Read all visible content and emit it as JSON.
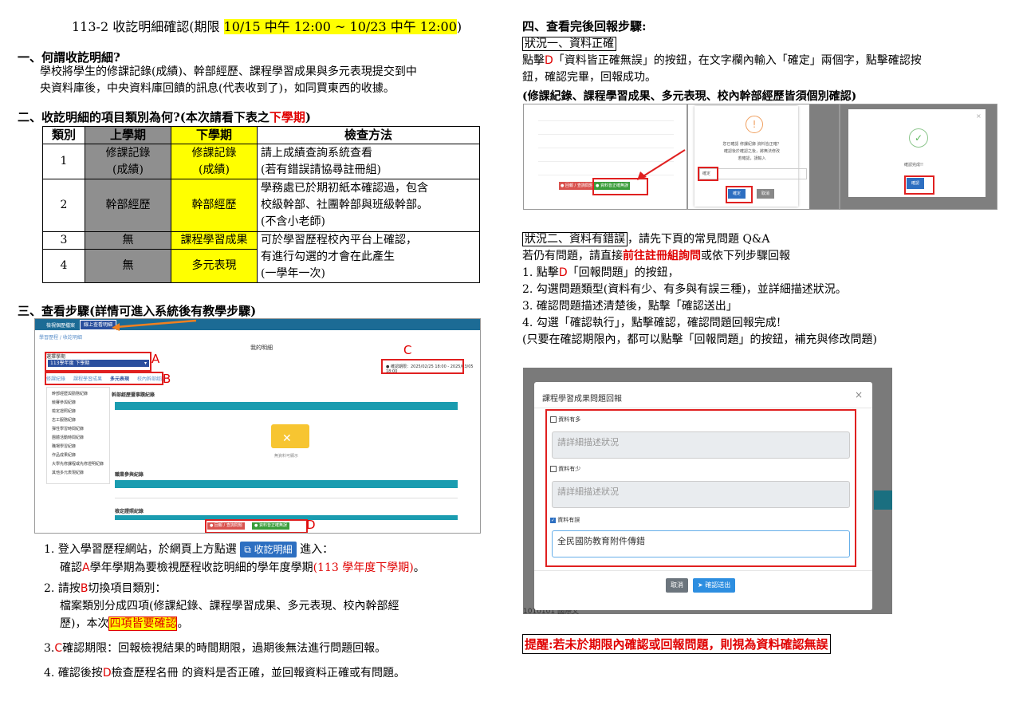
{
  "title": {
    "prefix": "113-2 收訖明細確認(期限 ",
    "deadline": "10/15 中午 12:00 ~ 10/23 中午 12:00",
    "suffix": ")"
  },
  "s1": {
    "heading": "一、何謂收訖明細?",
    "line1": "學校將學生的修課記錄(成績)、幹部經歷、課程學習成果與多元表現提交到中",
    "line2": "央資料庫後，中央資料庫回饋的訊息(代表收到了)，如同買東西的收據。"
  },
  "s2": {
    "heading": "二、收訖明細的項目類別為何?(本次請看下表之",
    "heading_red": "下學期",
    "heading_end": ")"
  },
  "table": {
    "headers": [
      "類別",
      "上學期",
      "下學期",
      "檢查方法"
    ],
    "rows": [
      {
        "no": "1",
        "prev": "修課記錄\n(成績)",
        "cur": "修課記錄\n(成績)",
        "method": "請上成績查詢系統查看\n(若有錯誤請協尋註冊組)"
      },
      {
        "no": "2",
        "prev": "幹部經歷",
        "cur": "幹部經歷",
        "method": "學務處已於期初紙本確認過，包含\n校級幹部、社團幹部與班級幹部。\n(不含小老師)"
      },
      {
        "no": "3",
        "prev": "無",
        "cur": "課程學習成果",
        "method": "可於學習歷程校內平台上確認，\n有進行勾選的才會在此產生\n(一學年一次)"
      },
      {
        "no": "4",
        "prev": "無",
        "cur": "多元表現"
      }
    ]
  },
  "s3": {
    "heading": "三、查看步驟(詳情可進入系統後有教學步驟)"
  },
  "screenshot1": {
    "tab1": "檢視個歷檔案",
    "tab2": "線上查看明細",
    "crumb": "學習歷程 / 收訖明細",
    "page_title": "我的明細",
    "select_label": "選擇學期",
    "select_value": "113學年度 下學期",
    "tabs": [
      "修課紀錄",
      "課程學習成果",
      "多元表現",
      "校內幹部經歷"
    ],
    "deadline_text": "● 確認期限：2025/02/25 18:00 - 2025/03/05 18:00",
    "side": [
      "幹部經歷與勤務紀錄",
      "競賽參與紀錄",
      "檢定證照紀錄",
      "志工服務紀錄",
      "彈性學習時間紀錄",
      "團體活動時間紀錄",
      "職場學習紀錄",
      "作品成果紀錄",
      "大學先修課程或先修證明紀錄",
      "其他多元表現紀錄"
    ],
    "section1": "幹部經歷暨事蹟紀錄",
    "empty": "無資料可顯示",
    "section2": "職業參與紀錄",
    "section3": "檢定證照紀錄",
    "btn_report": "● 回報 / 查詢問題",
    "btn_ok": "● 資料皆正確無誤",
    "labels": [
      "A",
      "B",
      "C",
      "D"
    ]
  },
  "steps": {
    "s1_a": "1. 登入學習歷程網站，於網頁上方點選",
    "s1_btn": "收訖明細",
    "s1_b": "進入：",
    "s1_2a": "確認",
    "s1_A": "A",
    "s1_2b": "學年學期為要檢視歷程收訖明細的學年度學期",
    "s1_2c": "(113 學年度下學期)",
    "s1_2d": "。",
    "s2_a": "2. 請按",
    "s2_B": "B",
    "s2_b": "切換項目類別：",
    "s2_2": "檔案類別分成四項(修課紀錄、課程學習成果、多元表現、校內幹部經",
    "s2_3a": "歷)，本次",
    "s2_3hl": "四項皆要確認",
    "s2_3b": "。",
    "s3_a": "3.",
    "s3_C": "C",
    "s3_b": "確認期限：回報檢視結果的時間期限，過期後無法進行問題回報。",
    "s4_a": "4. 確認後按",
    "s4_D": "D",
    "s4_b": "檢查歷程名冊 的資料是否正確，並回報資料正確或有問題。"
  },
  "s4": {
    "heading": "四、查看完後回報步驟:",
    "case1": "狀況一、資料正確",
    "c1_l1a": "點擊",
    "c1_D": "D",
    "c1_l1b": "「資料皆正確無誤」的按鈕，在文字欄內輸入「確定」兩個字，點擊確認按",
    "c1_l2": "鈕，確認完畢，回報成功。",
    "c1_bold": "(修課紀錄、課程學習成果、多元表現、校內幹部經歷皆須個別確認)"
  },
  "shot2": {
    "btn_report": "● 回報 / 查詢問題",
    "btn_ok": "● 資料皆正確無誤",
    "modal_q1": "您已確認 修課紀錄 資料皆正確？",
    "modal_q2": "確認後於確認之後，將無法修改",
    "modal_q3": "若確認，請輸入",
    "input": "確定",
    "ok": "確定",
    "cancel": "取消",
    "done": "確認完成!!",
    "done_btn": "確認"
  },
  "case2": {
    "label": "狀況二、資料有錯誤",
    "after": "，請先下頁的常見問題 Q&A",
    "l2a": "若仍有問題，請直接",
    "l2red": "前往註冊組詢問",
    "l2b": "或依下列步驟回報",
    "l3a": "1. 點擊",
    "l3D": "D",
    "l3b": "「回報問題」的按鈕，",
    "l4": "2. 勾選問題類型(資料有少、有多與有誤三種)，並詳細描述狀況。",
    "l5": "3. 確認問題描述清楚後，點擊「確認送出」",
    "l6": "4. 勾選「確認執行」，點擊確認，確認問題回報完成!",
    "l7": "(只要在確認期限內，都可以點擊「回報問題」的按鈕，補充與修改問題)"
  },
  "modal": {
    "title": "課程學習成果問題回報",
    "close": "×",
    "opt1": "資料有多",
    "opt2": "資料有少",
    "opt3": "資料有誤",
    "ph": "請詳細描述狀況",
    "value": "全民國防教育附件傳錯",
    "cancel": "取消",
    "submit": "確認送出",
    "bg_text": "1010101 國際文"
  },
  "reminder": "提醒:若未於期限內確認或回報問題，則視為資料確認無誤",
  "colors": {
    "red": "#e00000",
    "yellow": "#ffff00",
    "teal": "#1a9cb0",
    "blue": "#2d6fc1"
  }
}
